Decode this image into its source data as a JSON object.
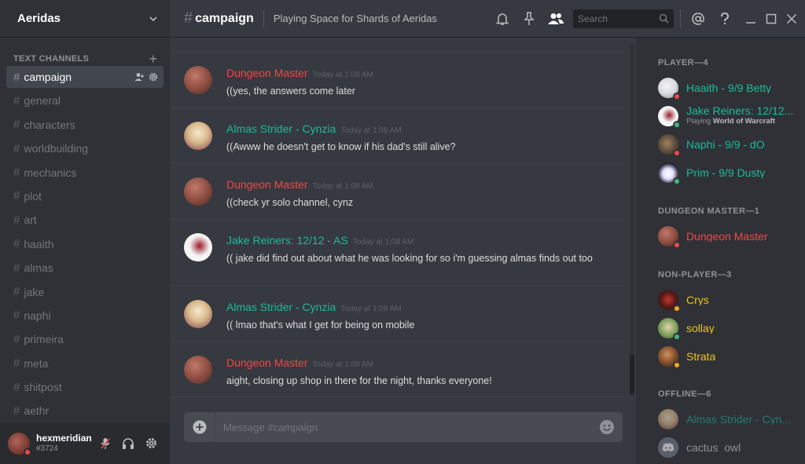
{
  "server": {
    "name": "Aeridas"
  },
  "channels": {
    "category": "TEXT CHANNELS",
    "items": [
      {
        "name": "campaign"
      },
      {
        "name": "general"
      },
      {
        "name": "characters"
      },
      {
        "name": "worldbuilding"
      },
      {
        "name": "mechanics"
      },
      {
        "name": "plot"
      },
      {
        "name": "art"
      },
      {
        "name": "haaith"
      },
      {
        "name": "almas"
      },
      {
        "name": "jake"
      },
      {
        "name": "naphi"
      },
      {
        "name": "primeira"
      },
      {
        "name": "meta"
      },
      {
        "name": "shitpost"
      },
      {
        "name": "aethr"
      }
    ]
  },
  "user": {
    "name": "hexmeridian",
    "tag": "#3724"
  },
  "header": {
    "channel": "campaign",
    "topic": "Playing Space for Shards of Aeridas",
    "search_placeholder": "Search"
  },
  "messages": [
    {
      "author": "Dungeon Master",
      "time": "Today at 1:08 AM",
      "text": "((yes, the answers come later"
    },
    {
      "author": "Almas Strider - Cynzia",
      "time": "Today at 1:08 AM",
      "text": "((Awww he doesn't get to know if his dad's still alive?"
    },
    {
      "author": "Dungeon Master",
      "time": "Today at 1:08 AM",
      "text": "((check yr solo channel, cynz"
    },
    {
      "author": "Jake Reiners: 12/12 - AS",
      "time": "Today at 1:08 AM",
      "text": "(( jake did find out about what he was looking for so i'm guessing almas finds out too"
    },
    {
      "author": "Almas Strider - Cynzia",
      "time": "Today at 1:09 AM",
      "text": "(( lmao that's what I get for being on mobile"
    },
    {
      "author": "Dungeon Master",
      "time": "Today at 1:09 AM",
      "text": "aight, closing up shop in there for the night, thanks everyone!"
    }
  ],
  "composer": {
    "placeholder": "Message #campaign"
  },
  "members": {
    "groups": [
      {
        "label": "PLAYER—4"
      },
      {
        "label": "DUNGEON MASTER—1"
      },
      {
        "label": "NON-PLAYER—3"
      },
      {
        "label": "OFFLINE—6"
      }
    ],
    "list": [
      {
        "name": "Haaith - 9/9 Betty",
        "activity_prefix": "",
        "activity_game": ""
      },
      {
        "name": "Jake Reiners: 12/12...",
        "activity_prefix": "Playing ",
        "activity_game": "World of Warcraft"
      },
      {
        "name": "Naphi - 9/9 - dO",
        "activity_prefix": "",
        "activity_game": ""
      },
      {
        "name": "Prim - 9/9 Dusty",
        "activity_prefix": "",
        "activity_game": ""
      },
      {
        "name": "Dungeon Master",
        "activity_prefix": "",
        "activity_game": ""
      },
      {
        "name": "Crys",
        "activity_prefix": "",
        "activity_game": ""
      },
      {
        "name": "sollay",
        "activity_prefix": "",
        "activity_game": ""
      },
      {
        "name": "Strata",
        "activity_prefix": "",
        "activity_game": ""
      },
      {
        "name": "Almas Strider - Cyn...",
        "activity_prefix": "",
        "activity_game": ""
      },
      {
        "name": "cactus_owl",
        "activity_prefix": "",
        "activity_game": ""
      }
    ]
  },
  "colors": {
    "dm": "#f04747",
    "player": "#1abc9c",
    "npc": "#f1c40f",
    "online": "#43b581",
    "dnd": "#f04747",
    "idle": "#faa61a"
  }
}
